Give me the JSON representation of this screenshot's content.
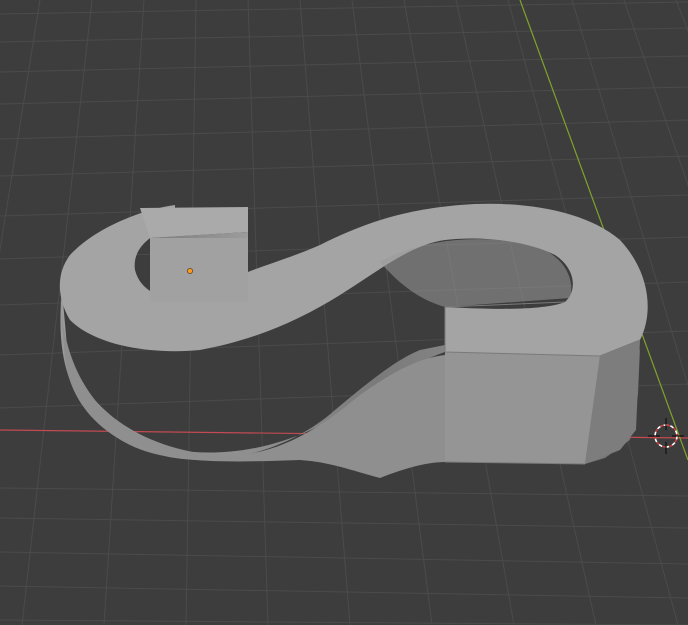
{
  "viewport": {
    "background": "#3d3d3d",
    "grid_color": "#4a4a4a",
    "x_axis_color": "#c24a52",
    "y_axis_color": "#7fa32b"
  },
  "scene": {
    "object": {
      "shape": "extruded-letter-s",
      "material_top": "#a3a3a3",
      "material_side": "#8c8c8c",
      "material_dark": "#6f6f6f",
      "origin_dot_color": "#ff9a1f"
    },
    "cursor": {
      "icon": "3d-cursor-icon",
      "ring_colors": [
        "#ffffff",
        "#d43b3b"
      ]
    }
  }
}
